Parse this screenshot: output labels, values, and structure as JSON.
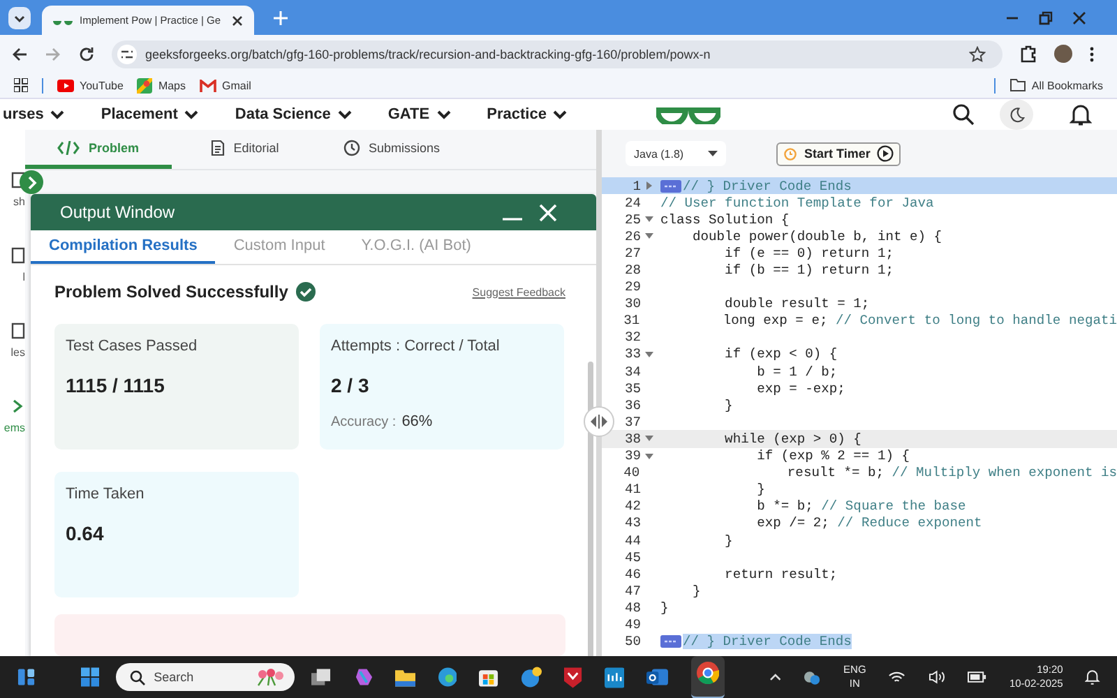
{
  "browser": {
    "tab_title": "Implement Pow | Practice | Ge",
    "url": "geeksforgeeks.org/batch/gfg-160-problems/track/recursion-and-backtracking-gfg-160/problem/powx-n",
    "bookmarks": [
      "YouTube",
      "Maps",
      "Gmail"
    ],
    "all_bookmarks": "All Bookmarks"
  },
  "site_nav": [
    "urses",
    "Placement",
    "Data Science",
    "GATE",
    "Practice"
  ],
  "sidebar": [
    {
      "label": "sh",
      "selected": false
    },
    {
      "label": "l",
      "selected": false
    },
    {
      "label": "les",
      "selected": false
    },
    {
      "label": "ems",
      "selected": true
    }
  ],
  "problem_tabs": [
    {
      "label": "Problem",
      "selected": true
    },
    {
      "label": "Editorial",
      "selected": false
    },
    {
      "label": "Submissions",
      "selected": false
    }
  ],
  "output_window": {
    "title": "Output Window",
    "tabs": [
      {
        "label": "Compilation Results",
        "selected": true
      },
      {
        "label": "Custom Input",
        "selected": false
      },
      {
        "label": "Y.O.G.I. (AI Bot)",
        "selected": false
      }
    ],
    "status": "Problem Solved Successfully",
    "feedback_link": "Suggest Feedback",
    "cards": [
      {
        "kind": "neutral",
        "label": "Test Cases Passed",
        "value": "1115 / 1115"
      },
      {
        "kind": "info",
        "label": "Attempts : Correct / Total",
        "value": "2 / 3",
        "note_label": "Accuracy :",
        "note_value": "66%"
      },
      {
        "kind": "info",
        "label": "Time Taken",
        "value": "0.64"
      }
    ]
  },
  "editor": {
    "language": "Java (1.8)",
    "timer_button": "Start Timer",
    "lines": [
      {
        "n": "1",
        "kind": "folded",
        "fold": true,
        "current": false,
        "comment": "// } Driver Code Ends"
      },
      {
        "n": "24",
        "kind": "code",
        "fold": false,
        "current": false,
        "comment": "// User function Template for Java"
      },
      {
        "n": "25",
        "kind": "code",
        "fold": true,
        "current": false,
        "code": "class Solution {"
      },
      {
        "n": "26",
        "kind": "code",
        "fold": true,
        "current": false,
        "code": "    double power(double b, int e) {"
      },
      {
        "n": "27",
        "kind": "code",
        "fold": false,
        "current": false,
        "code": "        if (e == 0) return 1;"
      },
      {
        "n": "28",
        "kind": "code",
        "fold": false,
        "current": false,
        "code": "        if (b == 1) return 1;"
      },
      {
        "n": "29",
        "kind": "code",
        "fold": false,
        "current": false
      },
      {
        "n": "30",
        "kind": "code",
        "fold": false,
        "current": false,
        "code": "        double result = 1;"
      },
      {
        "n": "31",
        "kind": "code",
        "fold": false,
        "current": false,
        "code": "        long exp = e; ",
        "comment": "// Convert to long to handle negati"
      },
      {
        "n": "32",
        "kind": "code",
        "fold": false,
        "current": false
      },
      {
        "n": "33",
        "kind": "code",
        "fold": true,
        "current": false,
        "code": "        if (exp < 0) {"
      },
      {
        "n": "34",
        "kind": "code",
        "fold": false,
        "current": false,
        "code": "            b = 1 / b;"
      },
      {
        "n": "35",
        "kind": "code",
        "fold": false,
        "current": false,
        "code": "            exp = -exp;"
      },
      {
        "n": "36",
        "kind": "code",
        "fold": false,
        "current": false,
        "code": "        }"
      },
      {
        "n": "37",
        "kind": "code",
        "fold": false,
        "current": false
      },
      {
        "n": "38",
        "kind": "code",
        "fold": true,
        "current": true,
        "code": "        while (exp > 0) {"
      },
      {
        "n": "39",
        "kind": "code",
        "fold": true,
        "current": false,
        "code": "            if (exp % 2 == 1) {"
      },
      {
        "n": "40",
        "kind": "code",
        "fold": false,
        "current": false,
        "code": "                result *= b; ",
        "comment": "// Multiply when exponent is"
      },
      {
        "n": "41",
        "kind": "code",
        "fold": false,
        "current": false,
        "code": "            }"
      },
      {
        "n": "42",
        "kind": "code",
        "fold": false,
        "current": false,
        "code": "            b *= b; ",
        "comment": "// Square the base"
      },
      {
        "n": "43",
        "kind": "code",
        "fold": false,
        "current": false,
        "code": "            exp /= 2; ",
        "comment": "// Reduce exponent"
      },
      {
        "n": "44",
        "kind": "code",
        "fold": false,
        "current": false,
        "code": "        }"
      },
      {
        "n": "45",
        "kind": "code",
        "fold": false,
        "current": false
      },
      {
        "n": "46",
        "kind": "code",
        "fold": false,
        "current": false,
        "code": "        return result;"
      },
      {
        "n": "47",
        "kind": "code",
        "fold": false,
        "current": false,
        "code": "    }"
      },
      {
        "n": "48",
        "kind": "code",
        "fold": false,
        "current": false,
        "code": "}"
      },
      {
        "n": "49",
        "kind": "code",
        "fold": false,
        "current": false
      },
      {
        "n": "50",
        "kind": "folded",
        "fold": false,
        "current": false,
        "comment": "// } Driver Code Ends"
      }
    ]
  },
  "taskbar": {
    "search_placeholder": "Search",
    "language": "ENG",
    "region": "IN",
    "time": "19:20",
    "date": "10-02-2025"
  }
}
